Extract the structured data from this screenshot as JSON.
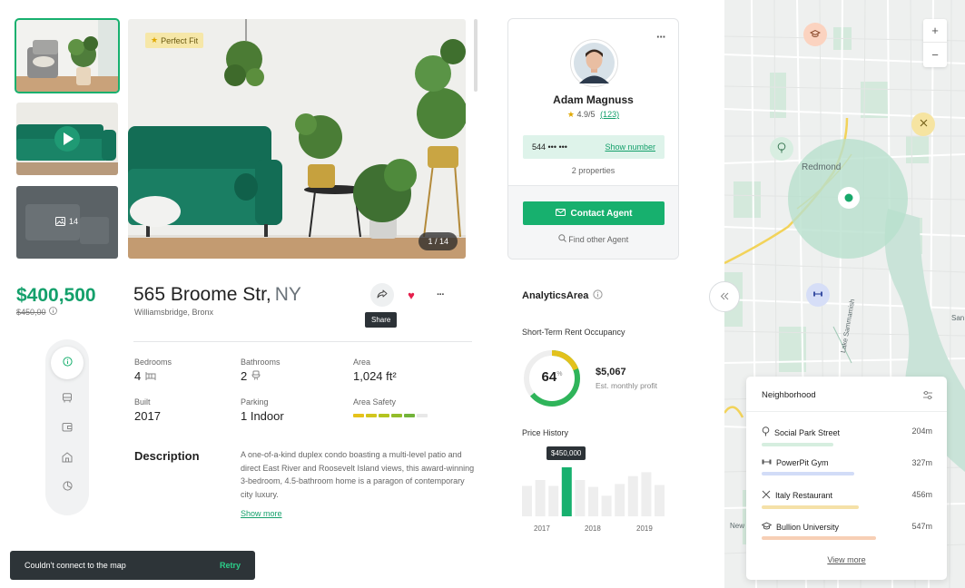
{
  "gallery": {
    "badge": "Perfect Fit",
    "counter": "1 / 14",
    "more_count": "14"
  },
  "agent": {
    "name": "Adam Magnuss",
    "rating": "4.9/5",
    "reviews": "(123)",
    "phone_masked": "544 ••• •••",
    "show_number": "Show number",
    "properties": "2 properties",
    "contact_button": "Contact Agent",
    "find_other": "Find other Agent",
    "more_icon": "···"
  },
  "listing": {
    "price": "$400,500",
    "old_price": "$450,00",
    "address": "565 Broome Str,",
    "state": "NY",
    "neighborhood": "Williamsbridge, Bronx",
    "share_tooltip": "Share",
    "stats": {
      "bedrooms_label": "Bedrooms",
      "bedrooms": "4",
      "bathrooms_label": "Bathrooms",
      "bathrooms": "2",
      "area_label": "Area",
      "area": "1,024 ft²",
      "built_label": "Built",
      "built": "2017",
      "parking_label": "Parking",
      "parking": "1 Indoor",
      "safety_label": "Area Safety"
    },
    "safety_colors": [
      "#e6c21a",
      "#d2c61d",
      "#b3c41f",
      "#93bd2a",
      "#72b33a",
      "#e8e8e8"
    ],
    "description_title": "Description",
    "description": "A one-of-a-kind duplex condo boasting a multi-level patio and direct East River and Roosevelt Island views, this award-winning 3-bedroom, 4.5-bathroom home is a paragon of contemporary city luxury.",
    "show_more": "Show more"
  },
  "toast": {
    "message": "Couldn't connect to the map",
    "action": "Retry"
  },
  "analytics": {
    "title": "AnalyticsArea",
    "occupancy_title": "Short-Term Rent Occupancy",
    "occupancy_percent": 64,
    "occupancy_label": "64",
    "percent_sign": "%",
    "profit": "$5,067",
    "profit_sub": "Est. monthly profit",
    "price_history_title": "Price History",
    "tooltip": "$450,000",
    "years": [
      "2017",
      "2018",
      "2019"
    ]
  },
  "chart_data": {
    "type": "bar",
    "bar_count": 11,
    "highlight_index": 3,
    "values": [
      0.62,
      0.74,
      0.62,
      1.0,
      0.74,
      0.6,
      0.42,
      0.66,
      0.82,
      0.9,
      0.64
    ],
    "highlight_value": "$450,000",
    "x_ticks": [
      "2017",
      "2018",
      "2019"
    ],
    "colors": {
      "bar": "#eeeeee",
      "highlight": "#17b06e"
    }
  },
  "map": {
    "city": "Redmond",
    "lake": "Lake Sammamish",
    "partial_label_1": "New",
    "partial_label_2": "San",
    "zoom_in": "+",
    "zoom_out": "−"
  },
  "neighborhood": {
    "title": "Neighborhood",
    "items": [
      {
        "name": "Social Park Street",
        "dist": "204m",
        "color": "#d6eedf",
        "fill": 0.42
      },
      {
        "name": "PowerPit Gym",
        "dist": "327m",
        "color": "#d2dcf7",
        "fill": 0.54
      },
      {
        "name": "Italy Restaurant",
        "dist": "456m",
        "color": "#f5e1a8",
        "fill": 0.57
      },
      {
        "name": "Bullion University",
        "dist": "547m",
        "color": "#f7cfb5",
        "fill": 0.67
      }
    ],
    "view_more": "View more"
  }
}
